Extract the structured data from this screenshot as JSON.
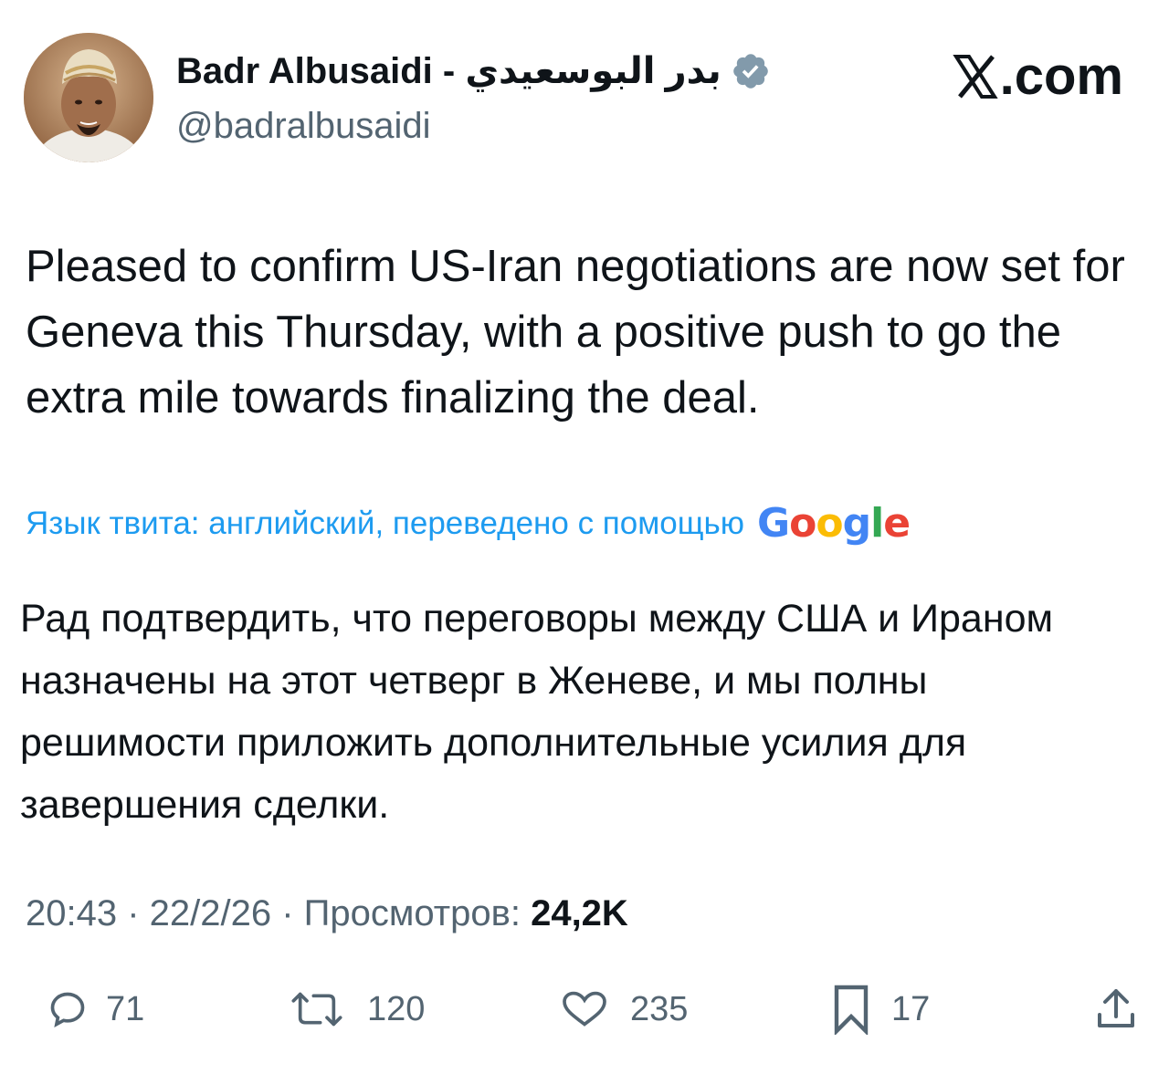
{
  "author": {
    "name": "Badr Albusaidi - بدر البوسعيدي",
    "handle": "@badralbusaidi",
    "verified": true
  },
  "brand": {
    "label": ".com"
  },
  "tweet": {
    "text": "Pleased to confirm US-Iran negotiations are now set for Geneva this Thursday, with a positive push to go the extra mile towards finalizing the deal."
  },
  "translation": {
    "notice": "Язык твита: английский, переведено с помощью",
    "provider": "Google",
    "text": "Рад подтвердить, что переговоры между США и Ираном назначены на этот четверг в Женеве, и мы полны решимости приложить дополнительные усилия для завершения сделки."
  },
  "meta": {
    "time": "20:43",
    "sep1": " · ",
    "date": "22/2/26",
    "sep2": " · ",
    "views_label": "Просмотров: ",
    "views_count": "24,2K"
  },
  "actions": {
    "replies": "71",
    "reposts": "120",
    "likes": "235",
    "bookmarks": "17"
  },
  "colors": {
    "accent": "#1d9bf0",
    "text_primary": "#0f1419",
    "text_secondary": "#536471",
    "verified_badge": "#829aab"
  }
}
